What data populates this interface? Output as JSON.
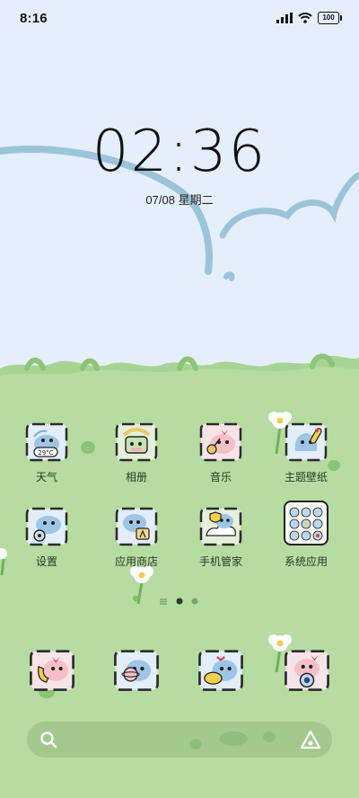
{
  "status_bar": {
    "time": "8:16",
    "battery": "100",
    "icons": [
      "signal-icon",
      "wifi-icon",
      "battery-icon"
    ]
  },
  "lockscreen": {
    "clock": "02:36",
    "date": "07/08 星期二"
  },
  "apps_row1": [
    {
      "label": "天气",
      "icon": "weather-icon",
      "badge": "29°C"
    },
    {
      "label": "相册",
      "icon": "gallery-icon"
    },
    {
      "label": "音乐",
      "icon": "music-icon"
    },
    {
      "label": "主题壁纸",
      "icon": "themes-icon"
    }
  ],
  "apps_row2": [
    {
      "label": "设置",
      "icon": "settings-icon"
    },
    {
      "label": "应用商店",
      "icon": "app-store-icon"
    },
    {
      "label": "手机管家",
      "icon": "security-icon"
    },
    {
      "label": "系统应用",
      "icon": "system-apps-folder-icon"
    }
  ],
  "pager": {
    "pages": 2,
    "current": 1
  },
  "dock": [
    "phone-icon",
    "browser-icon",
    "messages-icon",
    "camera-icon"
  ],
  "search_bar": {
    "icons": [
      "search-icon",
      "assistant-icon"
    ]
  },
  "colors": {
    "sky": "#e4effb",
    "grass": "#a8d493",
    "hill_stroke": "#9cc4d9",
    "icon_fill": "#c8e0f3"
  }
}
